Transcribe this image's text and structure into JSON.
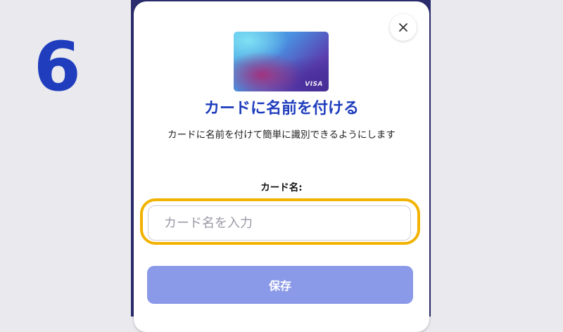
{
  "step": {
    "number": "6"
  },
  "dialog": {
    "close_icon": "close-icon",
    "card_brand": "VISA",
    "title": "カードに名前を付ける",
    "description": "カードに名前を付けて簡単に識別できるようにします",
    "field_label": "カード名:",
    "input_value": "",
    "input_placeholder": "カード名を入力",
    "save_label": "保存"
  },
  "colors": {
    "title_blue": "#1f3dbd",
    "step_number_blue": "#1f3dbd",
    "highlight_yellow": "#f2b200",
    "save_button_bg": "#8b9ae8",
    "page_background": "#e9e9ee"
  }
}
